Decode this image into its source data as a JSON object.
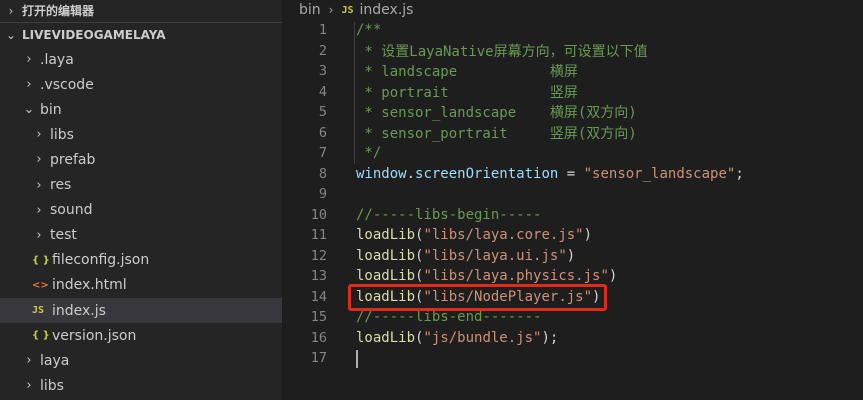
{
  "sidebar": {
    "open_editors_label": "打开的编辑器",
    "project_label": "LIVEVIDEOGAMELAYA",
    "items": [
      {
        "label": ".laya",
        "kind": "folder",
        "expanded": false
      },
      {
        "label": ".vscode",
        "kind": "folder",
        "expanded": false
      },
      {
        "label": "bin",
        "kind": "folder",
        "expanded": true
      },
      {
        "label": "libs",
        "kind": "folder",
        "expanded": false
      },
      {
        "label": "prefab",
        "kind": "folder",
        "expanded": false
      },
      {
        "label": "res",
        "kind": "folder",
        "expanded": false
      },
      {
        "label": "sound",
        "kind": "folder",
        "expanded": false
      },
      {
        "label": "test",
        "kind": "folder",
        "expanded": false
      },
      {
        "label": "fileconfig.json",
        "kind": "json",
        "icon": "{ }"
      },
      {
        "label": "index.html",
        "kind": "html",
        "icon": "<>"
      },
      {
        "label": "index.js",
        "kind": "js",
        "icon": "JS",
        "selected": true
      },
      {
        "label": "version.json",
        "kind": "json",
        "icon": "{ }"
      },
      {
        "label": "laya",
        "kind": "folder",
        "expanded": false
      },
      {
        "label": "libs",
        "kind": "folder",
        "expanded": false
      }
    ]
  },
  "breadcrumb": {
    "folder": "bin",
    "file_icon": "JS",
    "file": "index.js"
  },
  "editor": {
    "line_numbers": [
      "1",
      "2",
      "3",
      "4",
      "5",
      "6",
      "7",
      "8",
      "9",
      "10",
      "11",
      "12",
      "13",
      "14",
      "15",
      "16",
      "17"
    ],
    "lines": [
      [
        {
          "t": "/**",
          "c": "comment"
        }
      ],
      [
        {
          "t": " * 设置LayaNative屏幕方向，可设置以下值",
          "c": "comment"
        }
      ],
      [
        {
          "t": " * landscape           横屏",
          "c": "comment"
        }
      ],
      [
        {
          "t": " * portrait            竖屏",
          "c": "comment"
        }
      ],
      [
        {
          "t": " * sensor_landscape    横屏(双方向)",
          "c": "comment"
        }
      ],
      [
        {
          "t": " * sensor_portrait     竖屏(双方向)",
          "c": "comment"
        }
      ],
      [
        {
          "t": " */",
          "c": "comment"
        }
      ],
      [
        {
          "t": "window",
          "c": "var"
        },
        {
          "t": ".",
          "c": "plain"
        },
        {
          "t": "screenOrientation",
          "c": "var"
        },
        {
          "t": " = ",
          "c": "plain"
        },
        {
          "t": "\"sensor_landscape\"",
          "c": "str"
        },
        {
          "t": ";",
          "c": "plain"
        }
      ],
      [],
      [
        {
          "t": "//-----libs-begin-----",
          "c": "comment"
        }
      ],
      [
        {
          "t": "loadLib",
          "c": "fn"
        },
        {
          "t": "(",
          "c": "plain"
        },
        {
          "t": "\"libs/laya.core.js\"",
          "c": "str"
        },
        {
          "t": ")",
          "c": "plain"
        }
      ],
      [
        {
          "t": "loadLib",
          "c": "fn"
        },
        {
          "t": "(",
          "c": "plain"
        },
        {
          "t": "\"libs/laya.ui.js\"",
          "c": "str"
        },
        {
          "t": ")",
          "c": "plain"
        }
      ],
      [
        {
          "t": "loadLib",
          "c": "fn"
        },
        {
          "t": "(",
          "c": "plain"
        },
        {
          "t": "\"libs/laya.physics.js\"",
          "c": "str"
        },
        {
          "t": ")",
          "c": "plain"
        }
      ],
      [
        {
          "t": "loadLib",
          "c": "fn"
        },
        {
          "t": "(",
          "c": "plain"
        },
        {
          "t": "\"libs/NodePlayer.js\"",
          "c": "str"
        },
        {
          "t": ")",
          "c": "plain"
        }
      ],
      [
        {
          "t": "//-----libs-end-------",
          "c": "comment"
        }
      ],
      [
        {
          "t": "loadLib",
          "c": "fn"
        },
        {
          "t": "(",
          "c": "plain"
        },
        {
          "t": "\"js/bundle.js\"",
          "c": "str"
        },
        {
          "t": ");",
          "c": "plain"
        }
      ],
      []
    ]
  },
  "colors": {
    "highlight_box": "#e02b1b",
    "comment": "#6a9955",
    "string": "#ce9178",
    "function": "#dcdcaa",
    "variable": "#9cdcfe"
  }
}
